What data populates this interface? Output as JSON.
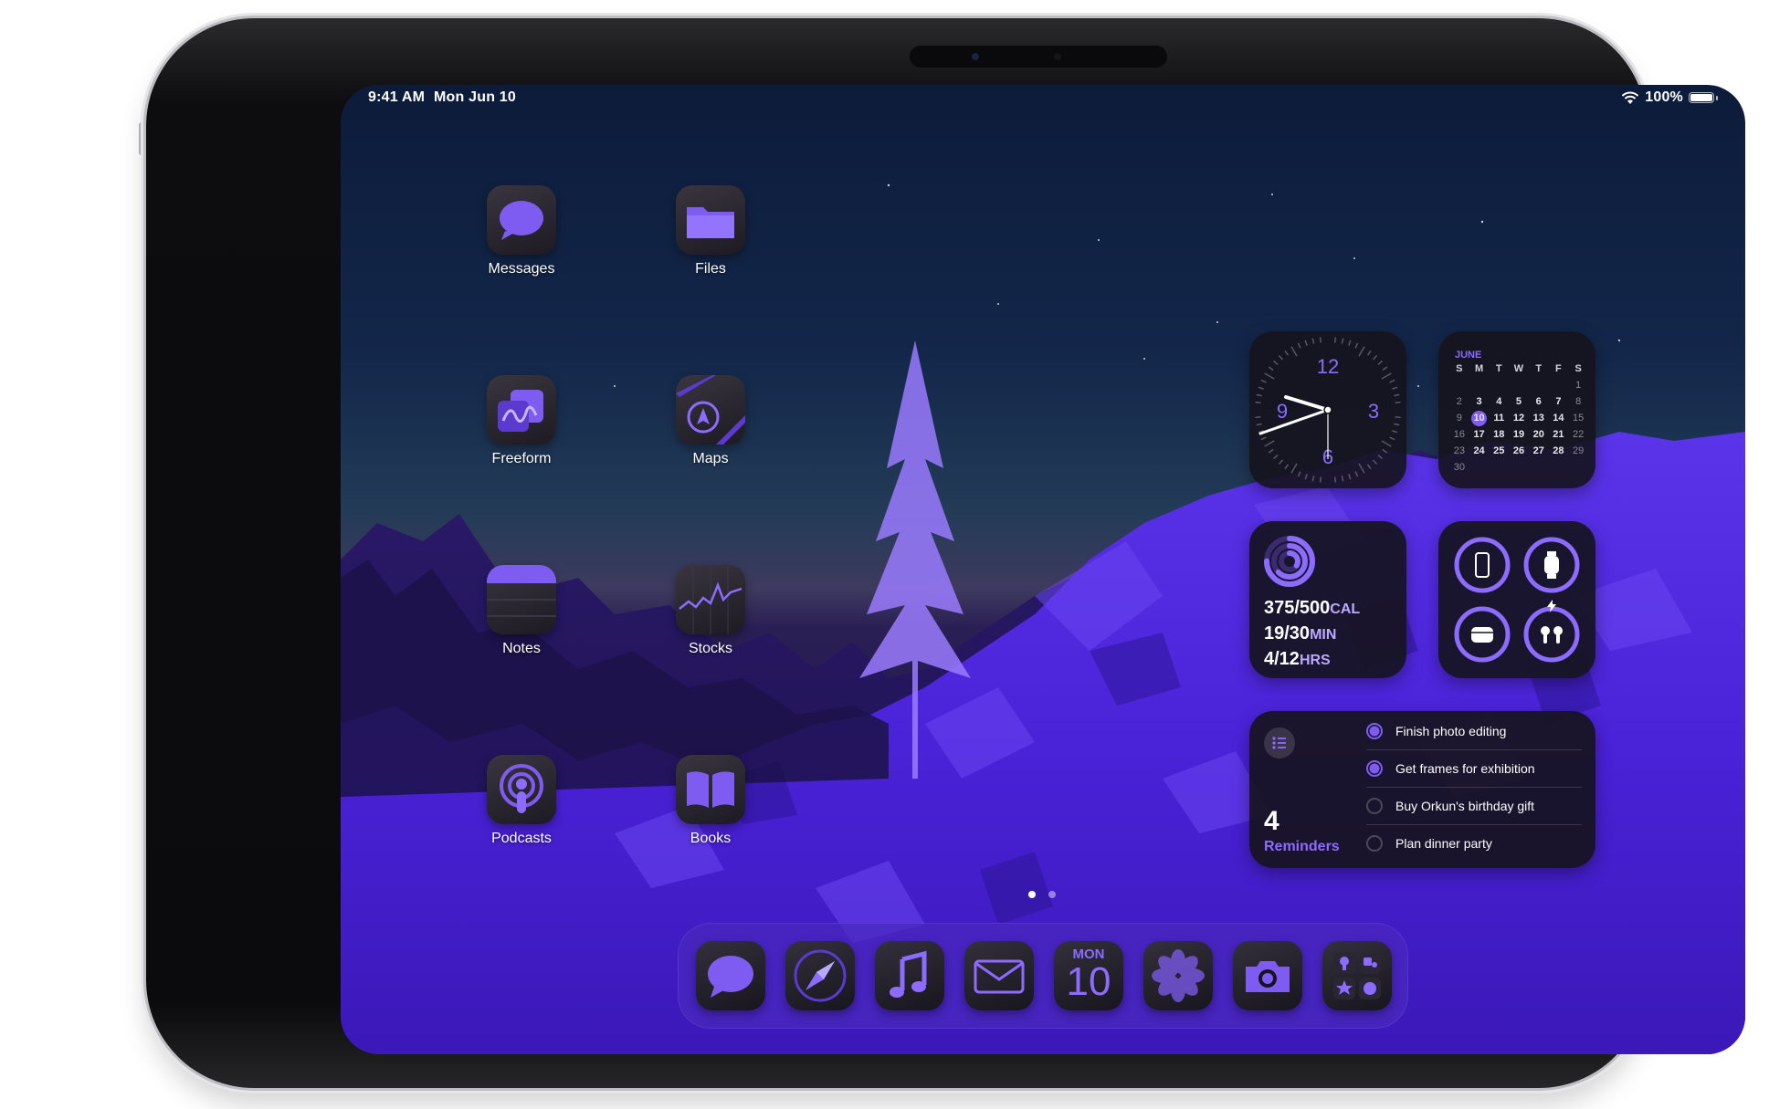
{
  "status_bar": {
    "time": "9:41 AM",
    "date": "Mon Jun 10",
    "battery": "100%",
    "battery_level": 1.0,
    "wifi_icon": "wifi-icon",
    "battery_icon": "battery-icon"
  },
  "apps": [
    {
      "label": "Messages",
      "icon": "messages-icon"
    },
    {
      "label": "Files",
      "icon": "files-icon"
    },
    {
      "label": "Freeform",
      "icon": "freeform-icon"
    },
    {
      "label": "Maps",
      "icon": "maps-icon"
    },
    {
      "label": "Notes",
      "icon": "notes-icon"
    },
    {
      "label": "Stocks",
      "icon": "stocks-icon"
    },
    {
      "label": "Podcasts",
      "icon": "podcasts-icon"
    },
    {
      "label": "Books",
      "icon": "books-icon"
    }
  ],
  "widgets": {
    "clock": {
      "n12": "12",
      "n3": "3",
      "n6": "6",
      "n9": "9"
    },
    "calendar": {
      "month": "JUNE",
      "weekdays": [
        "S",
        "M",
        "T",
        "W",
        "T",
        "F",
        "S"
      ],
      "rows": [
        [
          "",
          "",
          "",
          "",
          "",
          "",
          "1"
        ],
        [
          "2",
          "3",
          "4",
          "5",
          "6",
          "7",
          "8"
        ],
        [
          "9",
          "10",
          "11",
          "12",
          "13",
          "14",
          "15"
        ],
        [
          "16",
          "17",
          "18",
          "19",
          "20",
          "21",
          "22"
        ],
        [
          "23",
          "24",
          "25",
          "26",
          "27",
          "28",
          "29"
        ],
        [
          "30",
          "",
          "",
          "",
          "",
          "",
          ""
        ]
      ],
      "today": "10"
    },
    "fitness": {
      "move": "375/500",
      "move_unit": "CAL",
      "exercise": "19/30",
      "exercise_unit": "MIN",
      "stand": "4/12",
      "stand_unit": "HRS"
    },
    "batteries": {
      "devices": [
        "ipad-icon",
        "watch-icon",
        "airpods-case-icon",
        "airpods-icon"
      ],
      "charging_icon": "lightning-bolt-icon"
    },
    "reminders": {
      "count": "4",
      "label": "Reminders",
      "items": [
        {
          "text": "Finish photo editing",
          "done": true
        },
        {
          "text": "Get frames for exhibition",
          "done": true
        },
        {
          "text": "Buy Orkun's birthday gift",
          "done": false
        },
        {
          "text": "Plan dinner party",
          "done": false
        }
      ]
    }
  },
  "page_indicator": {
    "pages": 2,
    "current": 1
  },
  "dock": {
    "apps": [
      "messages-icon",
      "safari-icon",
      "music-icon",
      "mail-icon",
      "calendar-icon",
      "photos-icon",
      "camera-icon",
      "app-library-icon"
    ],
    "calendar_day": "MON",
    "calendar_date": "10"
  },
  "colors": {
    "accent": "#8c6bff",
    "accent_dark": "#7e5cf2",
    "rock": "#4a22d8",
    "dock": "#4a28be"
  }
}
